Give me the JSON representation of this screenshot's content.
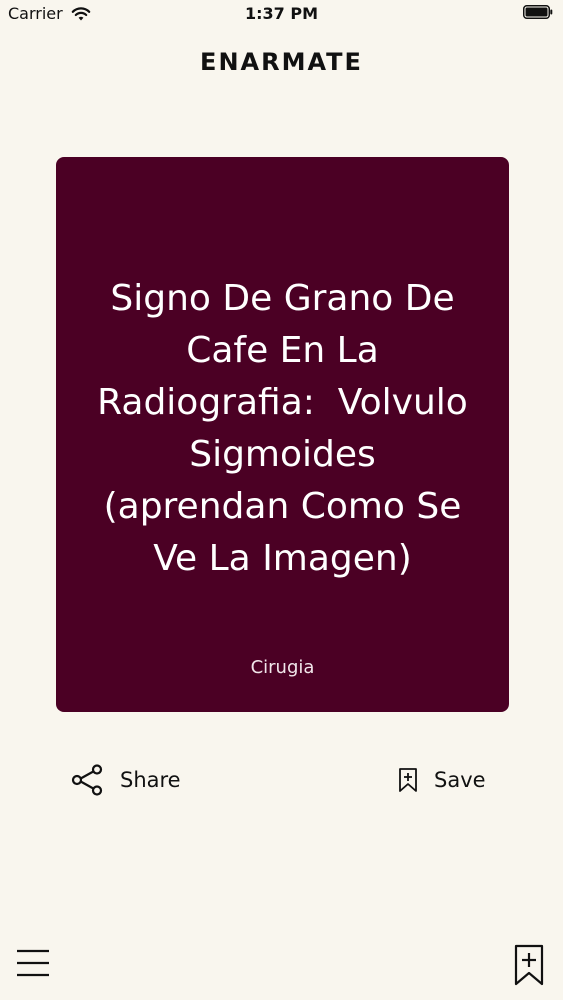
{
  "status_bar": {
    "carrier": "Carrier",
    "time": "1:37 PM"
  },
  "header": {
    "title": "ENARMATE"
  },
  "card": {
    "title": "Signo De Grano De\nCafe En La\nRadiografia:  Volvulo\nSigmoides\n(aprendan Como Se\nVe La Imagen)",
    "category": "Cirugia",
    "background_color": "#4b0024"
  },
  "actions": {
    "share_label": "Share",
    "save_label": "Save",
    "share_icon": "share-icon",
    "save_icon": "bookmark-add-icon"
  },
  "bottom_bar": {
    "menu_icon": "hamburger-menu-icon",
    "bookmarks_icon": "bookmark-add-icon"
  }
}
